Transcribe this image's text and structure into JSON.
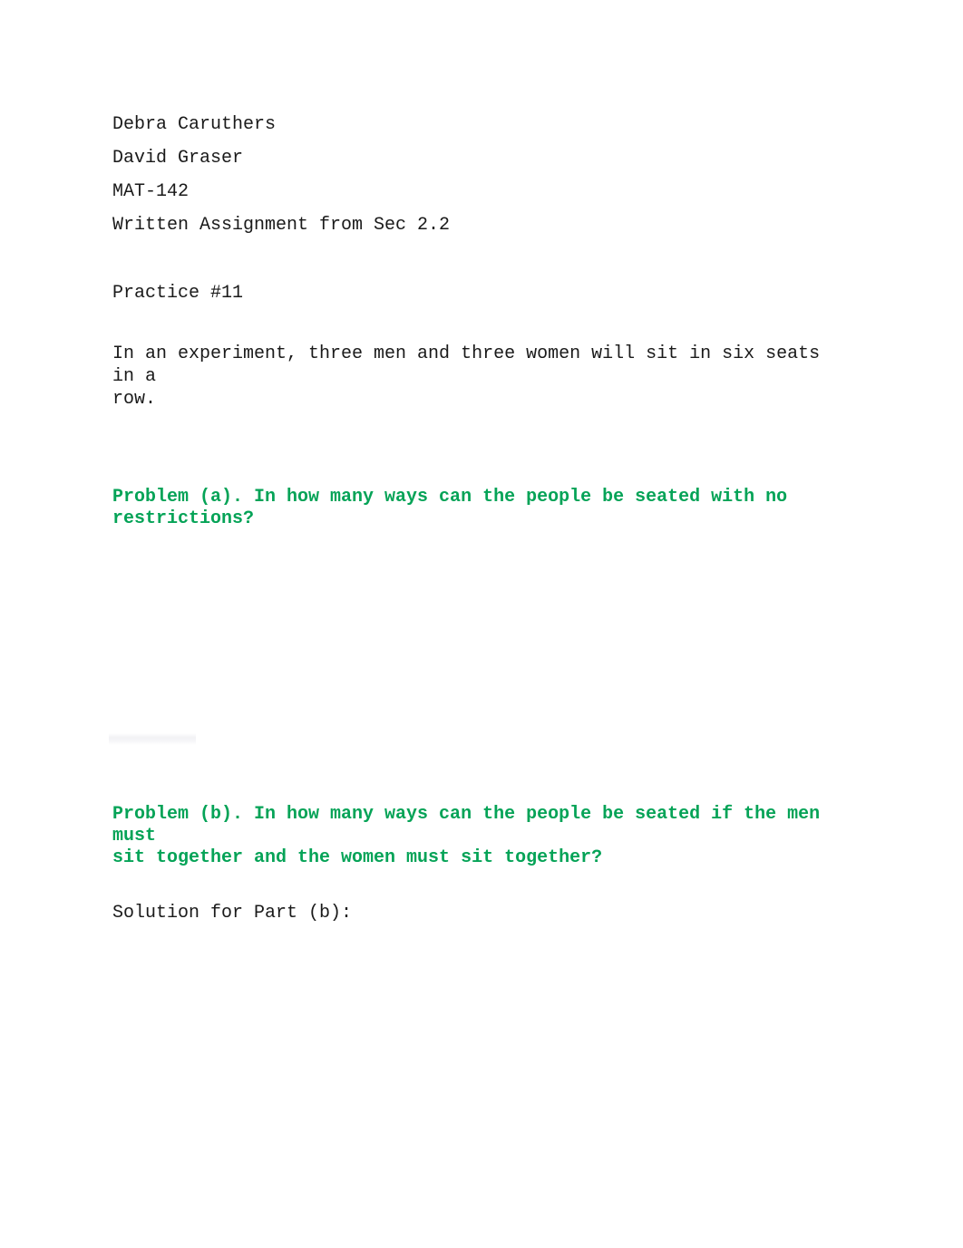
{
  "document": {
    "header": {
      "student_name": "Debra Caruthers",
      "instructor_name": "David Graser",
      "course_code": "MAT-142",
      "assignment_title": "Written Assignment from Sec 2.2"
    },
    "practice_label": "Practice #11",
    "prompt": "In an experiment, three men and three women will sit in six seats in a\nrow.",
    "problems": [
      {
        "id": "a",
        "text": "Problem (a). In how many ways can the people be seated with no\nrestrictions?",
        "solution_label": "",
        "solution_text": ""
      },
      {
        "id": "b",
        "text": "Problem (b). In how many ways can the people be seated if the men must\nsit together and the women must sit together?",
        "solution_label": "Solution for Part (b):",
        "solution_text": ""
      }
    ],
    "colors": {
      "problem_green": "#05a357",
      "body_text": "#1a1a1a",
      "page_background": "#ffffff"
    }
  }
}
